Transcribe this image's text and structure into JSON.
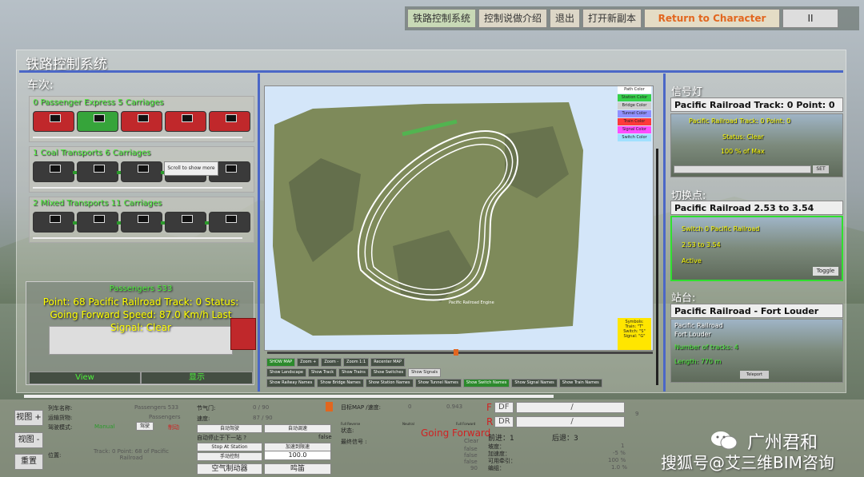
{
  "top_menu": {
    "items": [
      "铁路控制系统",
      "控制说做介绍",
      "退出",
      "打开新副本",
      "Return to Character"
    ],
    "pause_icon": "pause-icon"
  },
  "panel": {
    "title": "铁路控制系统",
    "trains_label": "车次:",
    "signal_label": "信号灯",
    "switch_label": "切换点:",
    "station_label": "站台:"
  },
  "trains": [
    {
      "title": "0 Passenger Express  5 Carriages",
      "carriages": [
        "red",
        "green",
        "red",
        "red",
        "red"
      ]
    },
    {
      "title": "1 Coal Transports  6 Carriages",
      "carriages": [
        "grey",
        "grey",
        "grey",
        "grey",
        "grey"
      ]
    },
    {
      "title": "2 Mixed Transports  11 Carriages",
      "carriages": [
        "grey",
        "grey",
        "grey",
        "grey",
        "grey"
      ]
    }
  ],
  "tooltip": "Scroll to show more",
  "info": {
    "passengers": "Passengers 533",
    "line1": "Point: 68 Pacific Railroad Track: 0 Status:",
    "line2": "Going Forward Speed: 87.0  Km/h Last",
    "line3": "Signal: Clear",
    "view_btn": "View",
    "show_btn": "显示"
  },
  "map": {
    "legend": [
      "Path Color",
      "Station Color",
      "Bridge Color",
      "Tunnel Color",
      "Train Color",
      "Signal Color",
      "Switch Color"
    ],
    "legend_colors": [
      "#ffffff",
      "#36d04a",
      "#cfcfcf",
      "#9090ff",
      "#ff3a3a",
      "#ff4dff",
      "#a0e0ff"
    ],
    "symbols": [
      "Symbols:",
      "Train: \"T\"",
      "Switch: \"S\"",
      "Signal: \"G\""
    ],
    "label_on_map": "Pacific Railroad Engine",
    "row1": [
      "SHOW MAP",
      "Zoom +",
      "Zoom -",
      "Zoom 1:1",
      "Recenter MAP"
    ],
    "row2": [
      "Show Landscape",
      "Show Track",
      "Show Trains",
      "Show Switches",
      "Show Signals"
    ],
    "row3": [
      "Show Railway Names",
      "Show Bridge Names",
      "Show Station Names",
      "Show Tunnel Names",
      "Show Switch Names",
      "Show Signal Names",
      "Show Train Names"
    ]
  },
  "signal": {
    "header": "Pacific Railroad Track: 0 Point: 0",
    "view_title": "Pacific Railroad Track: 0 Point: 0",
    "status": "Status: Clear",
    "percent": "100 % of Max",
    "set_btn": "SET"
  },
  "switch": {
    "header": "Pacific Railroad 2.53 to 3.54",
    "view_title": "Switch 0 Pacific Railroad",
    "range": "2.53 to 3.54",
    "state": "Active",
    "toggle_btn": "Toggle"
  },
  "station": {
    "header": "Pacific Railroad - Fort Louder",
    "line1": "Pacific Railroad",
    "line2": "Fort Louder",
    "line3": "Number of tracks: 4",
    "line4": "Length: 770 m",
    "teleport_btn": "Teleport"
  },
  "bottom": {
    "side_btn1": "视图 +",
    "side_btn2": "视图 -",
    "side_btn3": "重置",
    "train_name_label": "列车名称:",
    "train_name_value": "Passengers 533",
    "cargo_label": "运输货物:",
    "cargo_value": "Passengers",
    "mode_label": "驾驶模式:",
    "mode_manual": "Manual",
    "mode_auto": "驾驶",
    "mode_break": "制动",
    "position_label": "位置:",
    "position_value": "Track: 0 Point: 68 of Pacific Railroad",
    "brake_label": "节气门:",
    "brake_value": "0 / 90",
    "speed_label": "速度:",
    "speed_value": "87 / 90",
    "btn1": "自动驾驶",
    "btn2": "自动调速",
    "auto_stop_label": "自动停止于下一站 ?",
    "auto_stop_value": "false",
    "stop_btn": "Stop At Station",
    "btn3": "手动控制",
    "btn4": "加速到限速",
    "speed_input": "100.0",
    "air_brake": "空气制动器",
    "horn": "鸣笛",
    "target_label": "目标MAP /速度:",
    "target_value": "0",
    "target_speed": "0.943",
    "status_label": "状态:",
    "status_value": "Going Forward",
    "full_reverse": "Full Reverse",
    "neutral": "Neutral",
    "full_forward": "Full Forward",
    "signal_label": "最终信号 :",
    "signal_value": "Clear",
    "f_label": "F",
    "df": "DF",
    "r_label": "R",
    "dr": "DR",
    "slash": "/",
    "slash2": "/",
    "num1": "前进：1",
    "num3": "后退：3",
    "row_a_label": "坡度：",
    "row_a_value": "1",
    "row_b_label": "加速度：",
    "row_b_value": "-5 %",
    "row_c_label": "可用牵引：",
    "row_c_value": "100 %",
    "row_d_label": "编组：",
    "row_d_value": "1.0 %",
    "extra1": "false",
    "extra2": "false",
    "extra3": "false",
    "extra4": "90",
    "nine": "9",
    "watermark_1": "广州君和",
    "watermark_2": "搜狐号@艾三维BIM咨询"
  }
}
